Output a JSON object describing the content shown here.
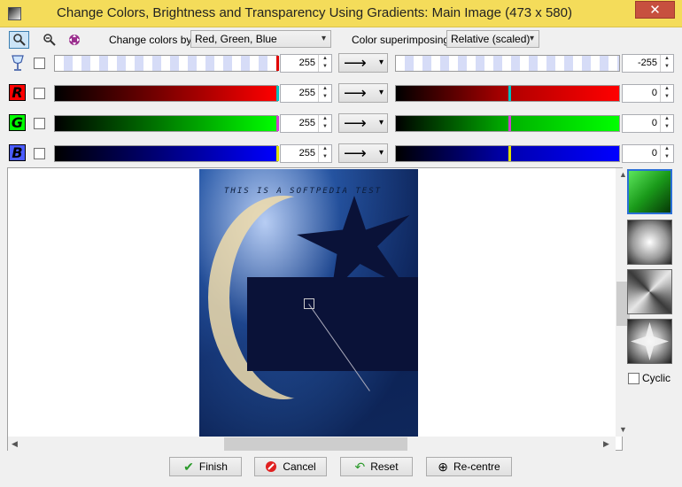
{
  "window": {
    "title": "Change Colors, Brightness and Transparency Using Gradients: Main Image (473 x 580)",
    "close_glyph": "✕"
  },
  "toolbar": {
    "tools": [
      "zoom-in-tool-icon",
      "zoom-out-tool-icon",
      "move-tool-icon"
    ],
    "change_colors_label": "Change colors by:",
    "change_colors_value": "Red, Green, Blue",
    "superimpose_label": "Color superimposing:",
    "superimpose_value": "Relative (scaled)"
  },
  "channels": [
    {
      "key": "transparency",
      "icon": "goblet-icon",
      "start_value": "255",
      "end_value": "-255",
      "arrow": "⟶",
      "checked": false
    },
    {
      "key": "red",
      "letter": "R",
      "color": "#ff0000",
      "start_value": "255",
      "end_value": "0",
      "arrow": "⟶",
      "checked": false
    },
    {
      "key": "green",
      "letter": "G",
      "color": "#00ff00",
      "start_value": "255",
      "end_value": "0",
      "arrow": "⟶",
      "checked": false
    },
    {
      "key": "blue",
      "letter": "B",
      "color": "#0000ff",
      "start_value": "255",
      "end_value": "0",
      "arrow": "⟶",
      "checked": false
    }
  ],
  "image": {
    "caption": "THIS IS A SOFTPEDIA TEST"
  },
  "presets": {
    "items": [
      "linear-gradient-preset",
      "radial-gradient-preset",
      "square-gradient-preset",
      "star-gradient-preset"
    ],
    "cyclic_label": "Cyclic",
    "cyclic_checked": false
  },
  "buttons": {
    "finish": "Finish",
    "cancel": "Cancel",
    "reset": "Reset",
    "recentre": "Re-centre"
  },
  "colors": {
    "titlebar": "#f4dc5a",
    "close": "#c7503f"
  }
}
